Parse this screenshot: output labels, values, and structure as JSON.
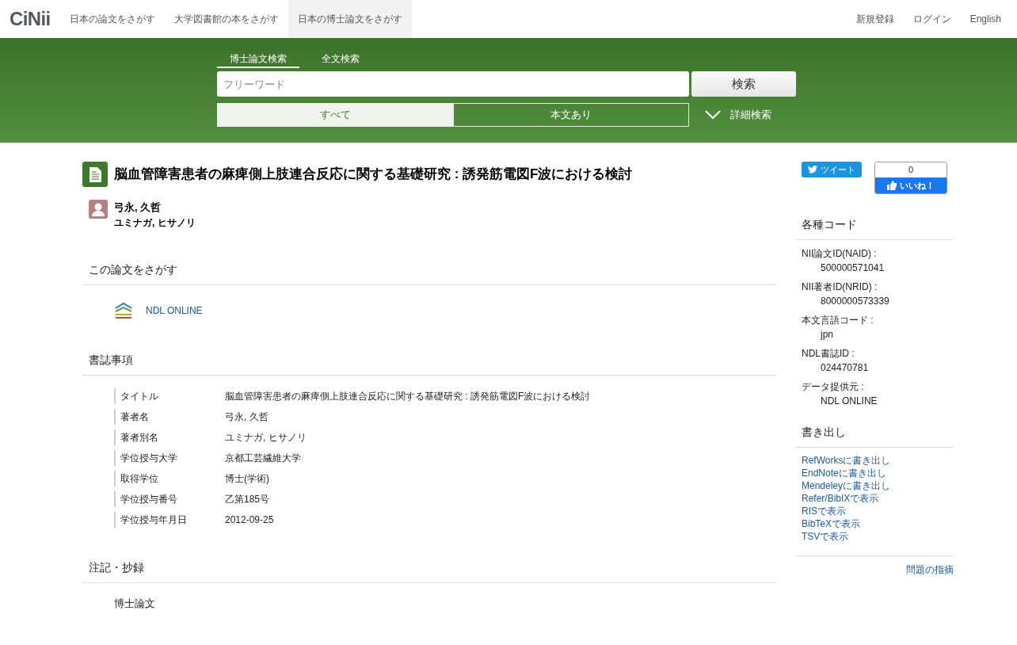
{
  "header": {
    "logo": "CiNii",
    "tabs": [
      {
        "label": "日本の論文をさがす",
        "selected": false
      },
      {
        "label": "大学図書館の本をさがす",
        "selected": false
      },
      {
        "label": "日本の博士論文をさがす",
        "selected": true
      }
    ],
    "links": [
      "新規登録",
      "ログイン",
      "English"
    ]
  },
  "search": {
    "tabs": [
      {
        "label": "博士論文検索",
        "selected": true
      },
      {
        "label": "全文検索",
        "selected": false
      }
    ],
    "placeholder": "フリーワード",
    "button": "検索",
    "filters": [
      {
        "label": "すべて",
        "selected": true
      },
      {
        "label": "本文あり",
        "selected": false
      }
    ],
    "advanced": "詳細検索"
  },
  "article": {
    "title": "脳血管障害患者の麻痺側上肢連合反応に関する基礎研究 : 誘発筋電図F波における検討",
    "author": "弓永, 久哲",
    "author_kana": "ユミナガ, ヒサノリ"
  },
  "find": {
    "heading": "この論文をさがす",
    "links": [
      "NDL ONLINE"
    ]
  },
  "biblio": {
    "heading": "書誌事項",
    "rows": [
      {
        "label": "タイトル",
        "value": "脳血管障害患者の麻痺側上肢連合反応に関する基礎研究 : 誘発筋電図F波における検討"
      },
      {
        "label": "著者名",
        "value": "弓永, 久哲"
      },
      {
        "label": "著者別名",
        "value": "ユミナガ, ヒサノリ"
      },
      {
        "label": "学位授与大学",
        "value": "京都工芸繊維大学"
      },
      {
        "label": "取得学位",
        "value": "博士(学術)"
      },
      {
        "label": "学位授与番号",
        "value": "乙第185号"
      },
      {
        "label": "学位授与年月日",
        "value": "2012-09-25"
      }
    ]
  },
  "notes": {
    "heading": "注記・抄録",
    "text": "博士論文"
  },
  "sidebar": {
    "tweet": "ツイート",
    "like_count": "0",
    "like": "いいね！",
    "codes_heading": "各種コード",
    "codes": [
      {
        "label": "NII論文ID(NAID) :",
        "value": "500000571041"
      },
      {
        "label": "NII著者ID(NRID) :",
        "value": "8000000573339"
      },
      {
        "label": "本文言語コード :",
        "value": "jpn"
      },
      {
        "label": "NDL書誌ID :",
        "value": "024470781"
      },
      {
        "label": "データ提供元 :",
        "value": "NDL ONLINE"
      }
    ],
    "export_heading": "書き出し",
    "exports": [
      "RefWorksに書き出し",
      "EndNoteに書き出し",
      "Mendeleyに書き出し",
      "Refer/BibIXで表示",
      "RISで表示",
      "BibTeXで表示",
      "TSVで表示"
    ],
    "report": "問題の指摘"
  }
}
